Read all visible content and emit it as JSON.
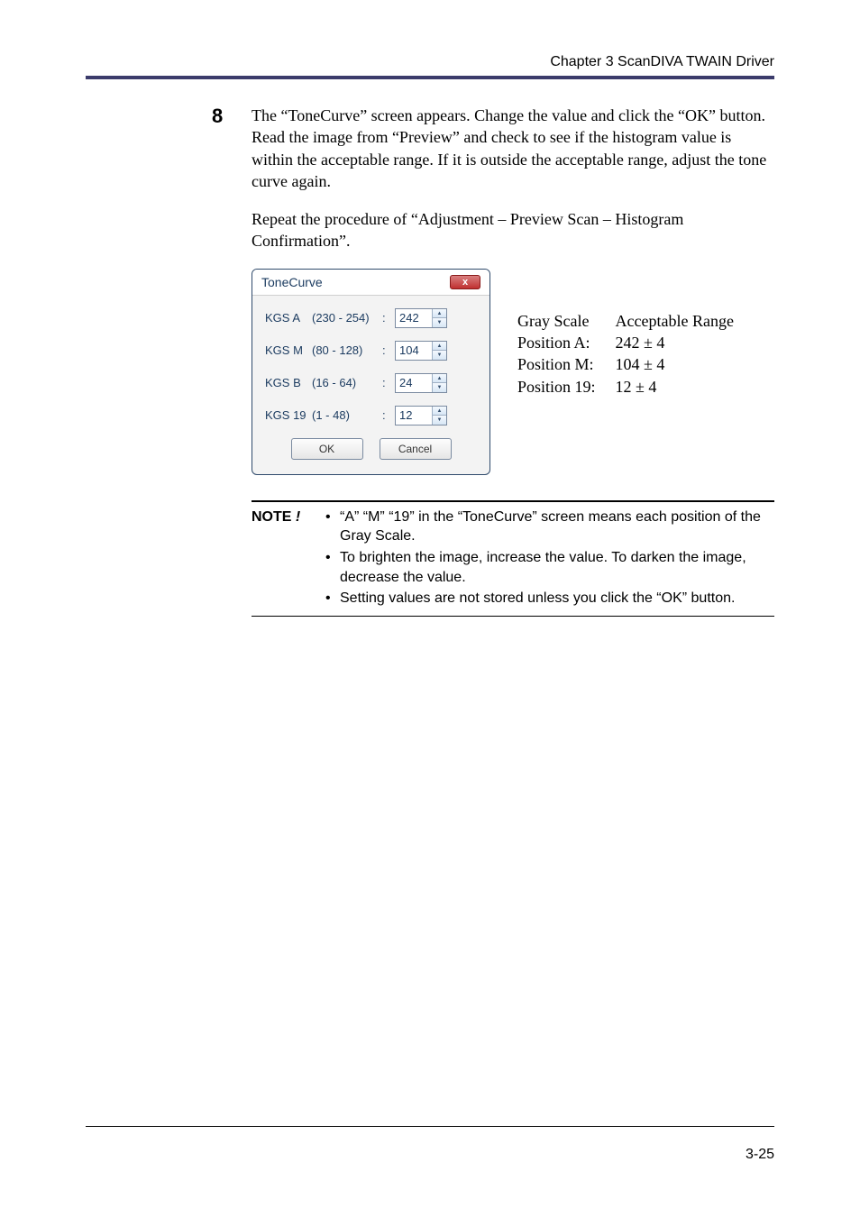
{
  "header": "Chapter 3  ScanDIVA TWAIN  Driver",
  "step": {
    "number": "8",
    "para1": "The “ToneCurve” screen appears. Change the value and click the “OK” button. Read the image from “Preview” and check to see if the histogram value is within the acceptable range. If it is outside the acceptable range, adjust the tone curve again.",
    "para2": "Repeat the procedure of “Adjustment – Preview Scan – Histogram Confirmation”."
  },
  "dialog": {
    "title": "ToneCurve",
    "close_glyph": "x",
    "rows": [
      {
        "label": "KGS A",
        "range": "(230 - 254)",
        "colon": ":",
        "value": "242"
      },
      {
        "label": "KGS M",
        "range": "(80 - 128)",
        "colon": ":",
        "value": "104"
      },
      {
        "label": "KGS B",
        "range": "(16 - 64)",
        "colon": ":",
        "value": "24"
      },
      {
        "label": "KGS 19",
        "range": "(1 - 48)",
        "colon": ":",
        "value": "12"
      }
    ],
    "ok": "OK",
    "cancel": "Cancel"
  },
  "sidetable": {
    "head": {
      "c1": "Gray Scale",
      "c2": "Acceptable Range"
    },
    "rows": [
      {
        "c1": "Position A:",
        "c2": "242 ± 4"
      },
      {
        "c1": "Position M:",
        "c2": "104 ± 4"
      },
      {
        "c1": "Position 19:",
        "c2": "12 ± 4"
      }
    ]
  },
  "note": {
    "label": "NOTE",
    "excl": "!",
    "items": [
      "“A” “M” “19” in the “ToneCurve” screen means each position of the Gray Scale.",
      "To brighten the image, increase the value. To darken the image, decrease the value.",
      "Setting values are not stored unless you click the “OK” button."
    ]
  },
  "footer": "3-25"
}
